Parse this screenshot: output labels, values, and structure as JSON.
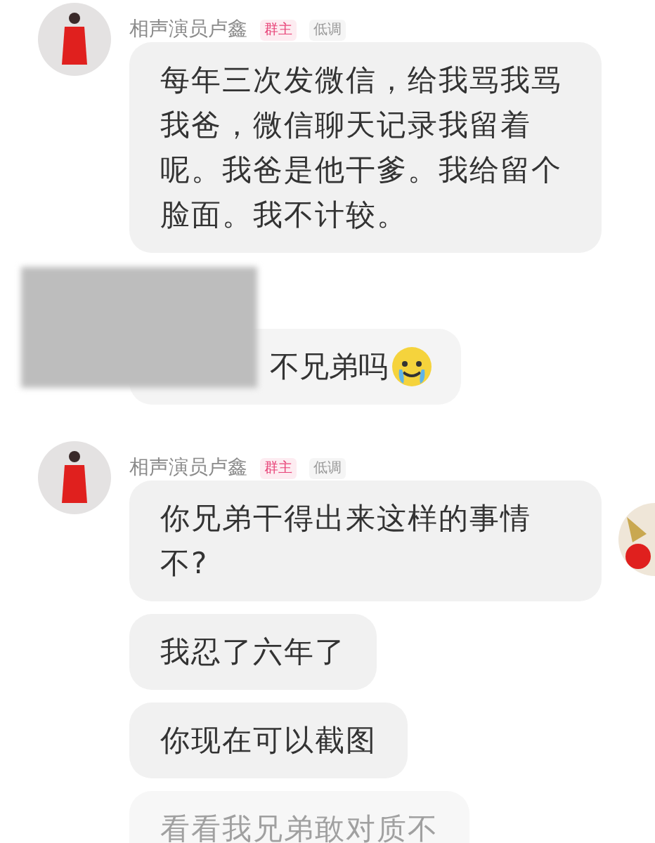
{
  "messages": [
    {
      "kind": "header",
      "name": "相声演员卢鑫",
      "tags": [
        {
          "label": "群主",
          "color": "#e8457a"
        },
        {
          "label": "低调",
          "color": "#9a9a9a"
        }
      ]
    },
    {
      "kind": "bubble",
      "text": "每年三次发微信，给我骂我骂我爸，微信聊天记录我留着呢。我爸是他干爹。我给留个脸面。我不计较。",
      "faded": false
    },
    {
      "kind": "redacted",
      "text": "不兄弟吗",
      "faded": false
    },
    {
      "kind": "header",
      "name": "相声演员卢鑫",
      "tags": [
        {
          "label": "群主",
          "color": "#e8457a"
        },
        {
          "label": "低调",
          "color": "#9a9a9a"
        }
      ]
    },
    {
      "kind": "bubble",
      "text": "你兄弟干得出来这样的事情不?",
      "faded": false
    },
    {
      "kind": "bubble",
      "text": "我忍了六年了",
      "faded": false
    },
    {
      "kind": "bubble",
      "text": "你现在可以截图",
      "faded": false
    },
    {
      "kind": "bubble",
      "text": "看看我兄弟敢对质不",
      "faded": true
    }
  ]
}
